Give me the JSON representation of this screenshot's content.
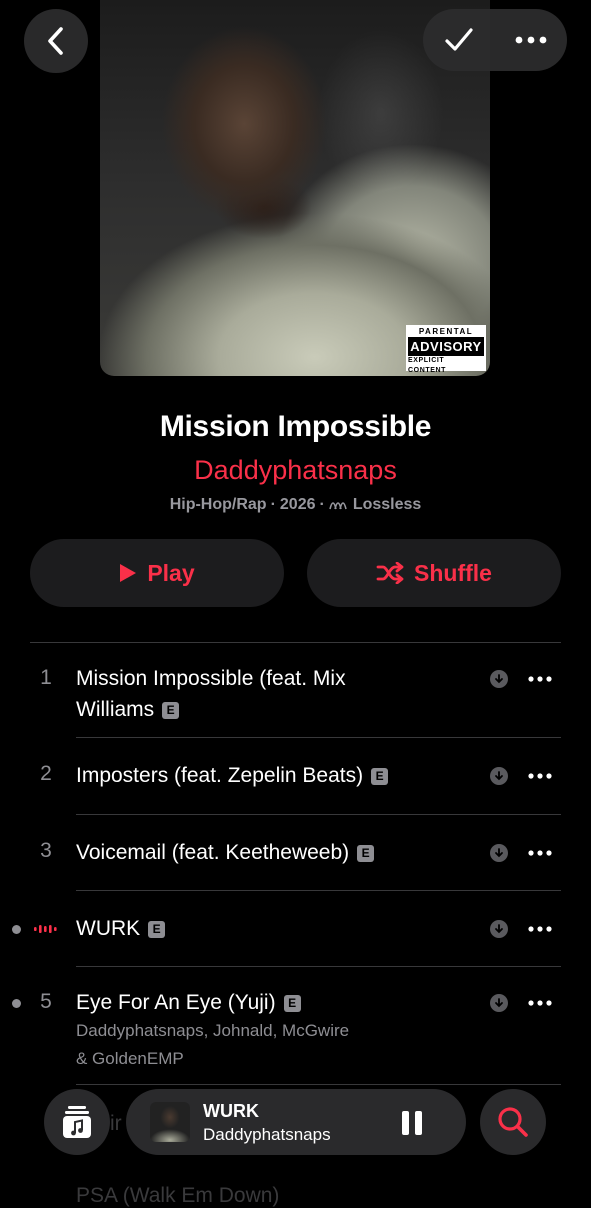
{
  "header": {
    "back_icon": "chevron-left-icon",
    "check_icon": "checkmark-icon",
    "more_icon": "ellipsis-icon"
  },
  "artwork": {
    "advisory_top": "PARENTAL",
    "advisory_mid": "ADVISORY",
    "advisory_bottom": "EXPLICIT CONTENT"
  },
  "album": {
    "title": "Mission Impossible",
    "artist": "Daddyphatsnaps",
    "genre": "Hip-Hop/Rap",
    "separator": "·",
    "year": "2026",
    "quality": "Lossless",
    "accent_color": "#fa3049"
  },
  "actions": {
    "play_label": "Play",
    "shuffle_label": "Shuffle"
  },
  "tracks": [
    {
      "number": "1",
      "title_line1": "Mission Impossible (feat. Mix",
      "title_line2": "Williams",
      "explicit": "E"
    },
    {
      "number": "2",
      "title": "Imposters (feat. Zepelin Beats)",
      "explicit": "E"
    },
    {
      "number": "3",
      "title": "Voicemail (feat. Keetheweeb)",
      "explicit": "E"
    },
    {
      "number": "",
      "title": "WURK",
      "explicit": "E",
      "now_playing": true
    },
    {
      "number": "5",
      "title": "Eye For An Eye (Yuji)",
      "explicit": "E",
      "artists_line1": "Daddyphatsnaps, Johnald, McGwire",
      "artists_line2": "& GoldenEMP"
    }
  ],
  "mini_player": {
    "title": "WURK",
    "artist": "Daddyphatsnaps"
  },
  "ghost_text": {
    "row6": "ir",
    "row7": "PSA (Walk Em Down)"
  }
}
